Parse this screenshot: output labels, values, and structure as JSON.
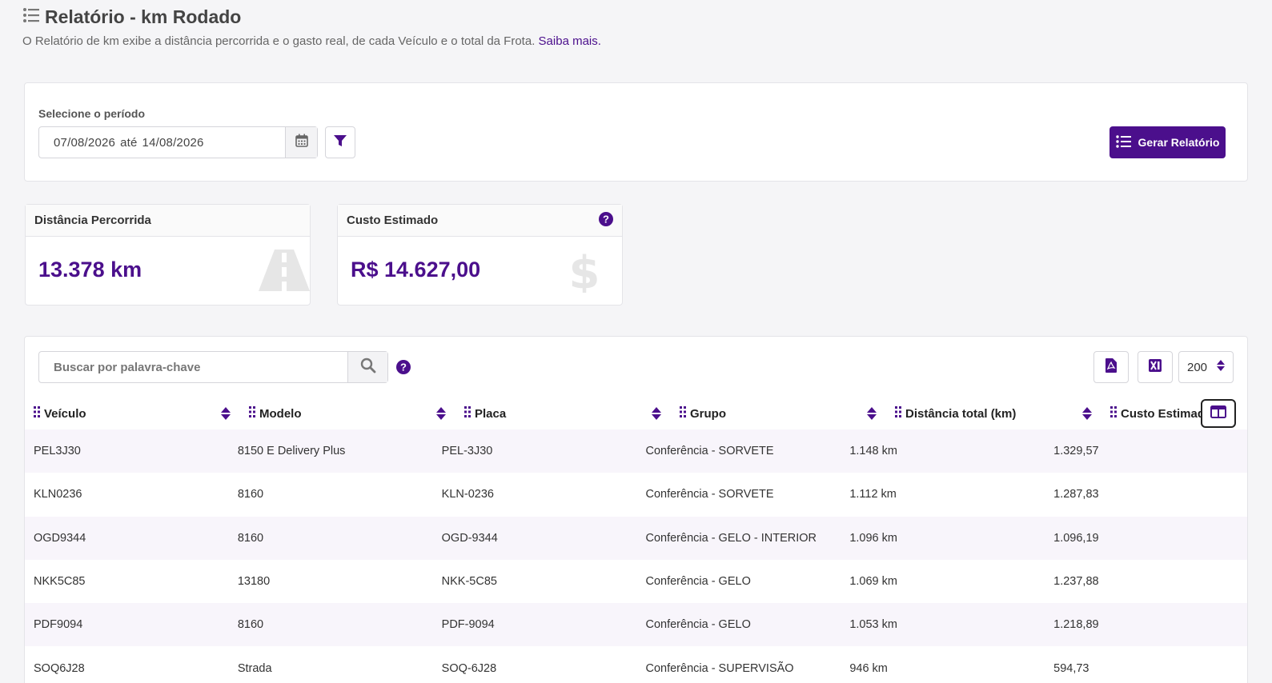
{
  "page": {
    "title": "Relatório - km Rodado",
    "subtitle": "O Relatório de km exibe a distância percorrida e o gasto real, de cada Veículo e o total da Frota.",
    "saiba_mais": "Saiba mais."
  },
  "period": {
    "label": "Selecione o período",
    "start": "07/08/2026",
    "separator": "até",
    "end": "14/08/2026",
    "generate_label": "Gerar Relatório"
  },
  "stats": {
    "distance": {
      "label": "Distância Percorrida",
      "value": "13.378 km"
    },
    "cost": {
      "label": "Custo Estimado",
      "value": "R$ 14.627,00"
    }
  },
  "table": {
    "search_placeholder": "Buscar por palavra-chave",
    "page_size": "200",
    "columns": [
      "Veículo",
      "Modelo",
      "Placa",
      "Grupo",
      "Distância total (km)",
      "Custo Estimado"
    ],
    "rows": [
      [
        "PEL3J30",
        "8150 E Delivery Plus",
        "PEL-3J30",
        "Conferência - SORVETE",
        "1.148 km",
        "1.329,57"
      ],
      [
        "KLN0236",
        "8160",
        "KLN-0236",
        "Conferência - SORVETE",
        "1.112 km",
        "1.287,83"
      ],
      [
        "OGD9344",
        "8160",
        "OGD-9344",
        "Conferência - GELO - INTERIOR",
        "1.096 km",
        "1.096,19"
      ],
      [
        "NKK5C85",
        "13180",
        "NKK-5C85",
        "Conferência - GELO",
        "1.069 km",
        "1.237,88"
      ],
      [
        "PDF9094",
        "8160",
        "PDF-9094",
        "Conferência - GELO",
        "1.053 km",
        "1.218,89"
      ],
      [
        "SOQ6J28",
        "Strada",
        "SOQ-6J28",
        "Conferência - SUPERVISÃO",
        "946 km",
        "594,73"
      ]
    ]
  },
  "colors": {
    "accent": "#4b0f8c"
  },
  "icons": {
    "title": "list-icon",
    "calendar": "calendar-icon",
    "filter": "filter-icon",
    "generate": "list-icon",
    "road": "road-icon",
    "dollar": "dollar-icon",
    "help": "question-circle-icon",
    "search": "search-icon",
    "pdf": "pdf-file-icon",
    "excel": "excel-file-icon",
    "columns": "columns-icon"
  }
}
